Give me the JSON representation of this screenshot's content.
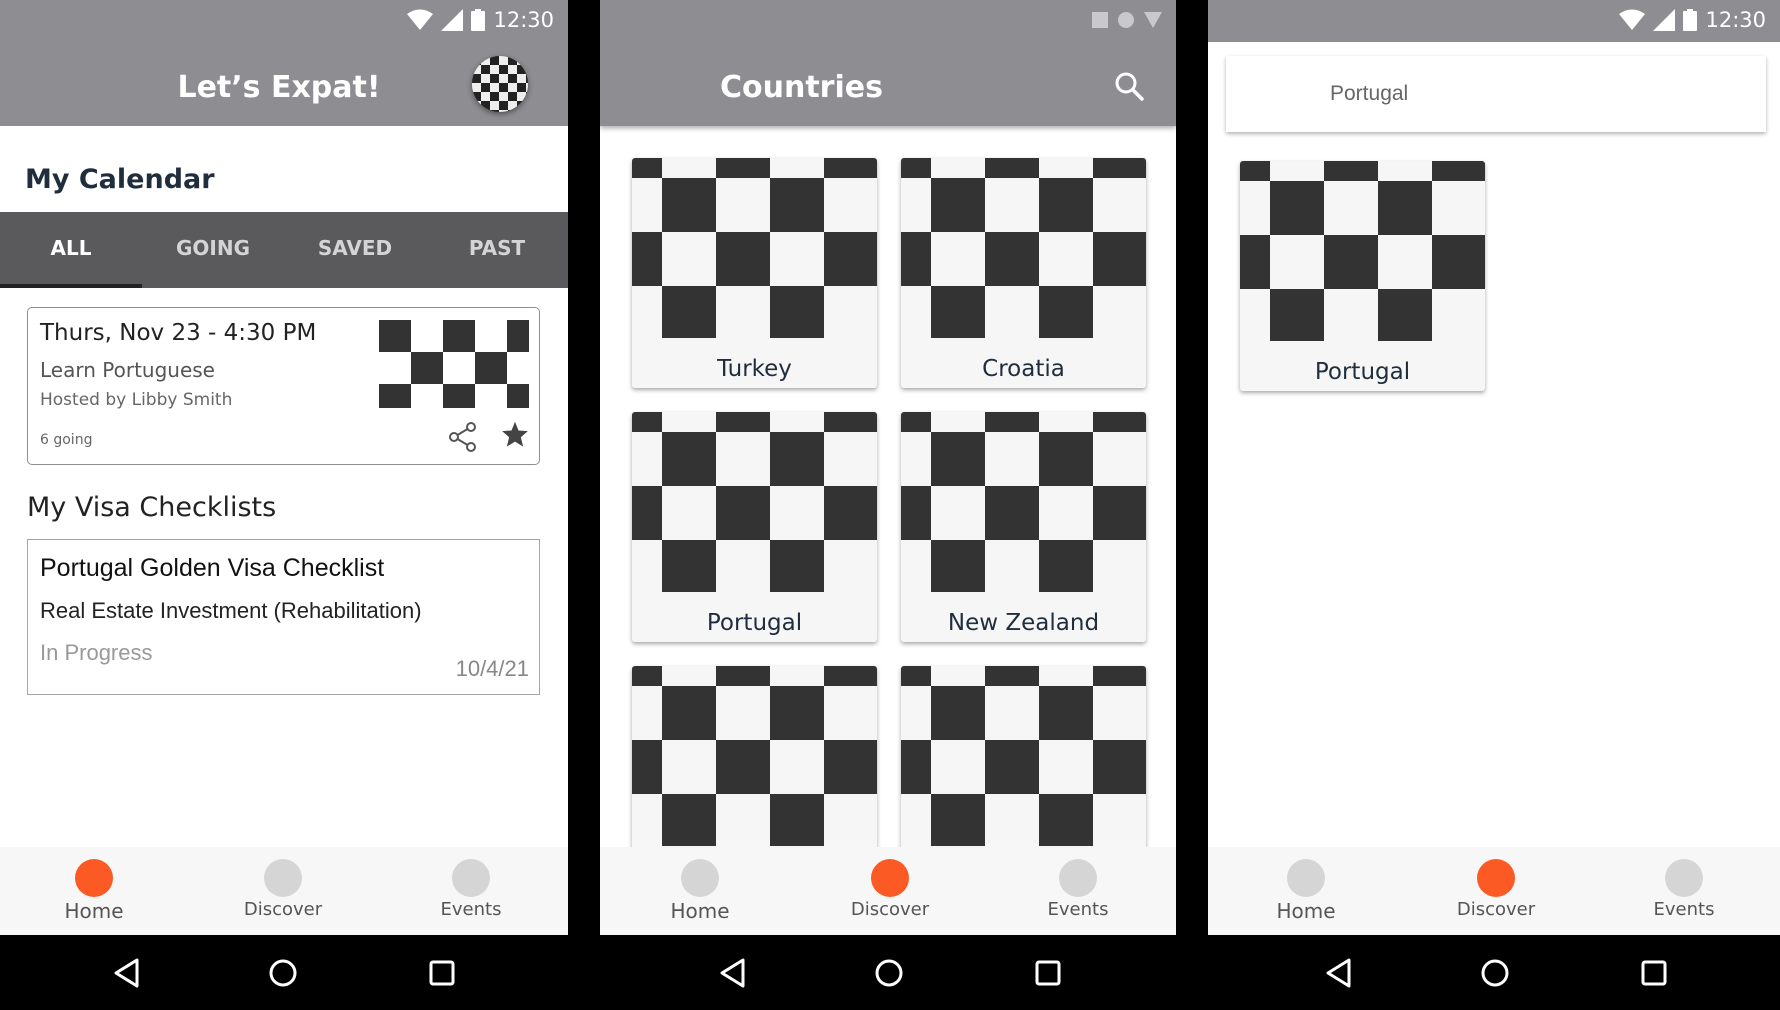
{
  "status_bar": {
    "time": "12:30"
  },
  "home": {
    "app_title": "Let’s Expat!",
    "calendar_title": "My Calendar",
    "tabs": [
      "ALL",
      "GOING",
      "SAVED",
      "PAST"
    ],
    "active_tab": "ALL",
    "event": {
      "date": "Thurs, Nov 23 - 4:30 PM",
      "title": "Learn Portuguese",
      "host": "Hosted by Libby Smith",
      "going": "6 going"
    },
    "visa_title": "My Visa Checklists",
    "visa": {
      "title": "Portugal Golden Visa Checklist",
      "type": "Real Estate Investment (Rehabilitation)",
      "status": "In Progress",
      "date": "10/4/21"
    }
  },
  "countries": {
    "title": "Countries",
    "tiles": [
      "Turkey",
      "Croatia",
      "Portugal",
      "New Zealand",
      "",
      ""
    ]
  },
  "search": {
    "query": "Portugal",
    "results": [
      "Portugal"
    ]
  },
  "bottom_nav": [
    "Home",
    "Discover",
    "Events"
  ],
  "icons": [
    "wifi-icon",
    "signal-icon",
    "battery-icon",
    "search-icon",
    "share-icon",
    "star-icon",
    "back-icon",
    "home-circle-icon",
    "recents-icon"
  ],
  "colors": {
    "accent": "#fc5a24",
    "bar": "#8e8e92",
    "tabs": "#5a5a5d"
  }
}
